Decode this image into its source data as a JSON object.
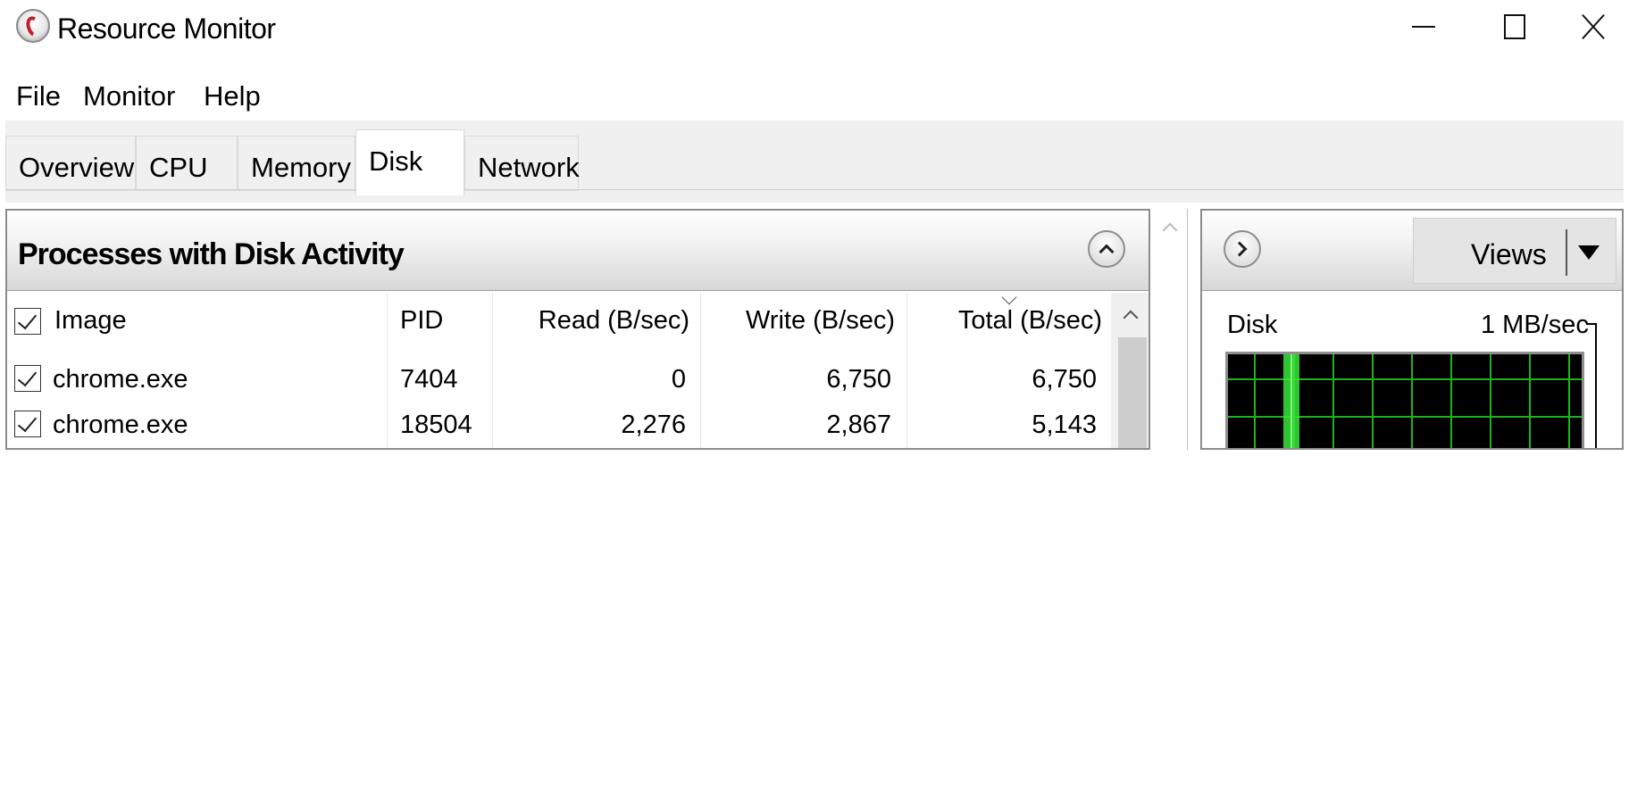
{
  "window": {
    "title": "Resource Monitor",
    "icon": "resource-monitor-gauge-icon"
  },
  "menu": {
    "items": [
      "File",
      "Monitor",
      "Help"
    ]
  },
  "tabs": [
    {
      "label": "Overview",
      "active": false
    },
    {
      "label": "CPU",
      "active": false
    },
    {
      "label": "Memory",
      "active": false
    },
    {
      "label": "Disk",
      "active": true
    },
    {
      "label": "Network",
      "active": false
    }
  ],
  "processes_panel": {
    "title": "Processes with Disk Activity",
    "columns": [
      "Image",
      "PID",
      "Read (B/sec)",
      "Write (B/sec)",
      "Total (B/sec)"
    ],
    "sorted_column": "Total (B/sec)",
    "sort_direction": "descending",
    "rows": [
      {
        "checked": true,
        "image": "chrome.exe",
        "pid": "7404",
        "read": "0",
        "write": "6,750",
        "total": "6,750"
      },
      {
        "checked": true,
        "image": "chrome.exe",
        "pid": "18504",
        "read": "2,276",
        "write": "2,867",
        "total": "5,143"
      }
    ]
  },
  "graph_panel": {
    "views_label": "Views",
    "graph_title": "Disk",
    "graph_scale": "1 MB/sec",
    "colors": {
      "grid": "#1db31d",
      "activity": "#39e639",
      "background": "#000000"
    }
  }
}
